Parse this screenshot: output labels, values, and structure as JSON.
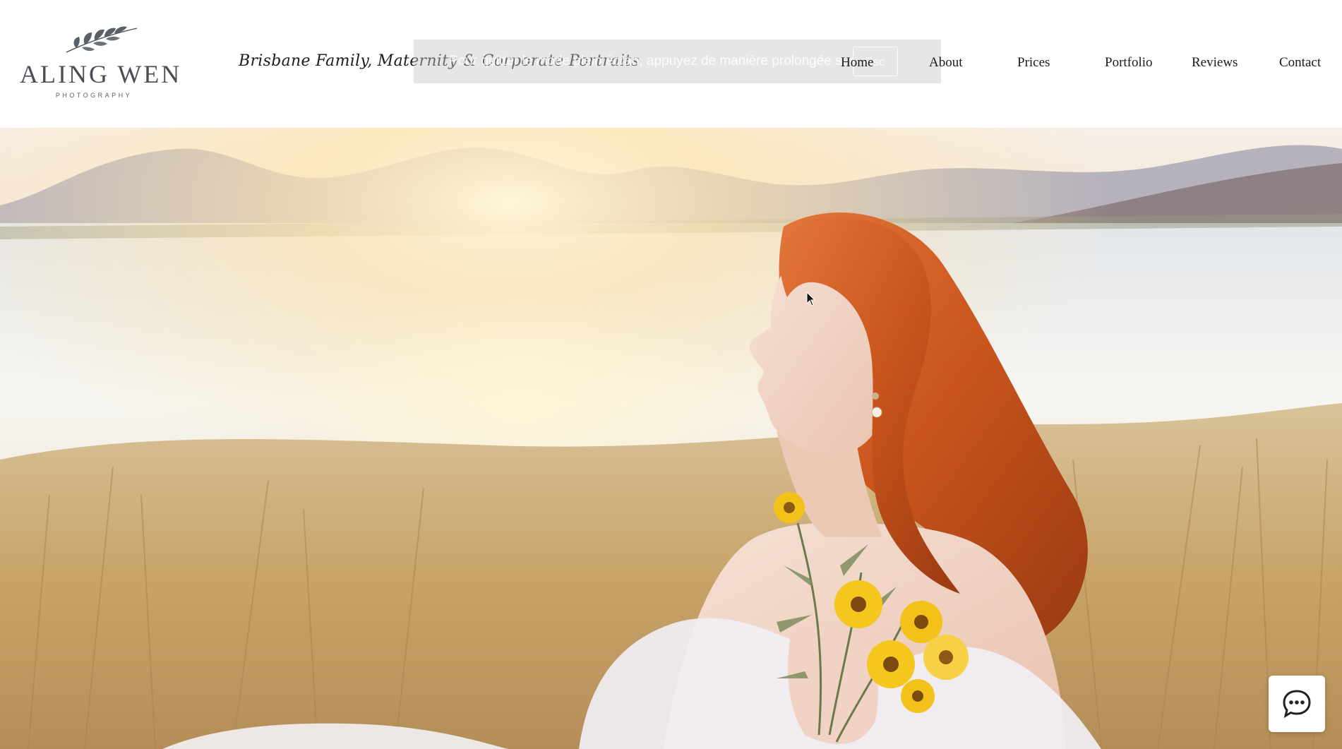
{
  "header": {
    "logo": {
      "name": "ALING WEN",
      "sub": "PHOTOGRAPHY",
      "icon": "olive-branch-icon"
    },
    "tagline": "Brisbane Family, Maternity & Corporate Portraits",
    "fullscreen_hint": "Pour quitter le mode plein écran, appuyez de manière prolongée sur",
    "fullscreen_hint_key": "Esc"
  },
  "nav": {
    "items": [
      {
        "label": "Home"
      },
      {
        "label": "About"
      },
      {
        "label": "Prices"
      },
      {
        "label": "Portfolio"
      },
      {
        "label": "Reviews"
      },
      {
        "label": "Contact"
      }
    ]
  },
  "hero": {
    "image": "portrait-woman-red-hair-sunflowers-lake-sunset"
  },
  "chat": {
    "icon": "chat-bubble-icon"
  },
  "colors": {
    "logo": "#4a4d55",
    "nav_text": "#1a1a1a",
    "accent_hair": "#c8541c",
    "flower": "#f2c21a"
  }
}
